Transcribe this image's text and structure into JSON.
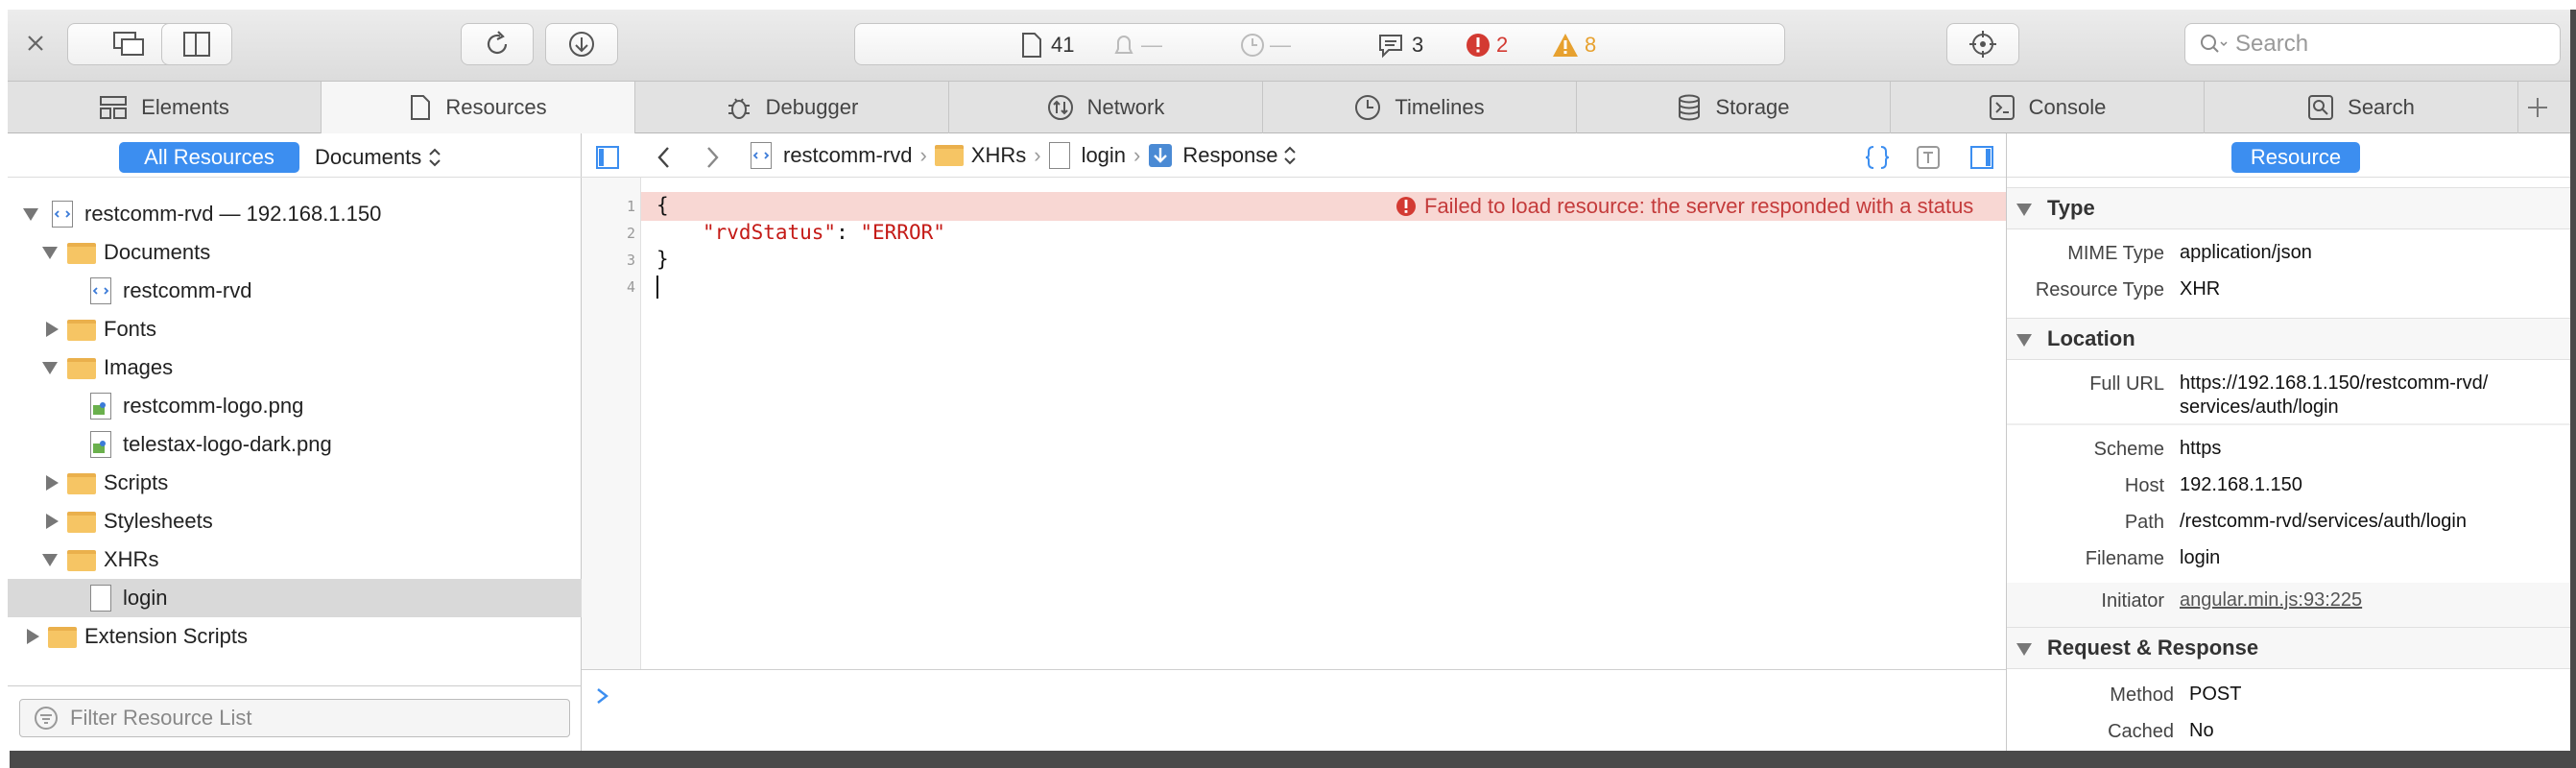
{
  "toolbar": {
    "resource_count": "41",
    "bell_placeholder": "—",
    "clock_placeholder": "—",
    "log_count": "3",
    "error_count": "2",
    "warning_count": "8",
    "search_placeholder": "Search",
    "colors": {
      "error": "#d33a32",
      "warning": "#e7a12f"
    }
  },
  "tabs": [
    {
      "label": "Elements",
      "icon": "elements-icon"
    },
    {
      "label": "Resources",
      "icon": "resources-icon"
    },
    {
      "label": "Debugger",
      "icon": "bug-icon"
    },
    {
      "label": "Network",
      "icon": "network-icon"
    },
    {
      "label": "Timelines",
      "icon": "clock-icon"
    },
    {
      "label": "Storage",
      "icon": "database-icon"
    },
    {
      "label": "Console",
      "icon": "console-icon"
    },
    {
      "label": "Search",
      "icon": "search-icon"
    }
  ],
  "sidebar": {
    "filter_all": "All Resources",
    "filter_type": "Documents",
    "tree": [
      {
        "label": "restcomm-rvd — 192.168.1.150"
      },
      {
        "label": "Documents"
      },
      {
        "label": "restcomm-rvd"
      },
      {
        "label": "Fonts"
      },
      {
        "label": "Images"
      },
      {
        "label": "restcomm-logo.png"
      },
      {
        "label": "telestax-logo-dark.png"
      },
      {
        "label": "Scripts"
      },
      {
        "label": "Stylesheets"
      },
      {
        "label": "XHRs"
      },
      {
        "label": "login"
      },
      {
        "label": "Extension Scripts"
      }
    ],
    "filter_placeholder": "Filter Resource List"
  },
  "breadcrumb": {
    "root": "restcomm-rvd",
    "folder": "XHRs",
    "file": "login",
    "view": "Response"
  },
  "editor": {
    "lines": [
      {
        "num": "1",
        "text": "{"
      },
      {
        "num": "2",
        "key": "\"rvdStatus\"",
        "sep": ": ",
        "value": "\"ERROR\""
      },
      {
        "num": "3",
        "text": "}"
      },
      {
        "num": "4",
        "text": ""
      }
    ],
    "error_message": "Failed to load resource: the server responded with a status",
    "colors": {
      "json_key": "#c41a16",
      "json_string": "#c41a16",
      "error_bg": "#f8d7d3"
    }
  },
  "details": {
    "tab_label": "Resource",
    "type_section": "Type",
    "mime_label": "MIME Type",
    "mime_value": "application/json",
    "rtype_label": "Resource Type",
    "rtype_value": "XHR",
    "location_section": "Location",
    "url_label": "Full URL",
    "url_value_1": "https://192.168.1.150/restcomm-rvd/",
    "url_value_2": "services/auth/login",
    "scheme_label": "Scheme",
    "scheme_value": "https",
    "host_label": "Host",
    "host_value": "192.168.1.150",
    "path_label": "Path",
    "path_value": "/restcomm-rvd/services/auth/login",
    "filename_label": "Filename",
    "filename_value": "login",
    "initiator_label": "Initiator",
    "initiator_value": "angular.min.js:93:225",
    "reqres_section": "Request & Response",
    "method_label": "Method",
    "method_value": "POST",
    "cached_label": "Cached",
    "cached_value": "No"
  }
}
